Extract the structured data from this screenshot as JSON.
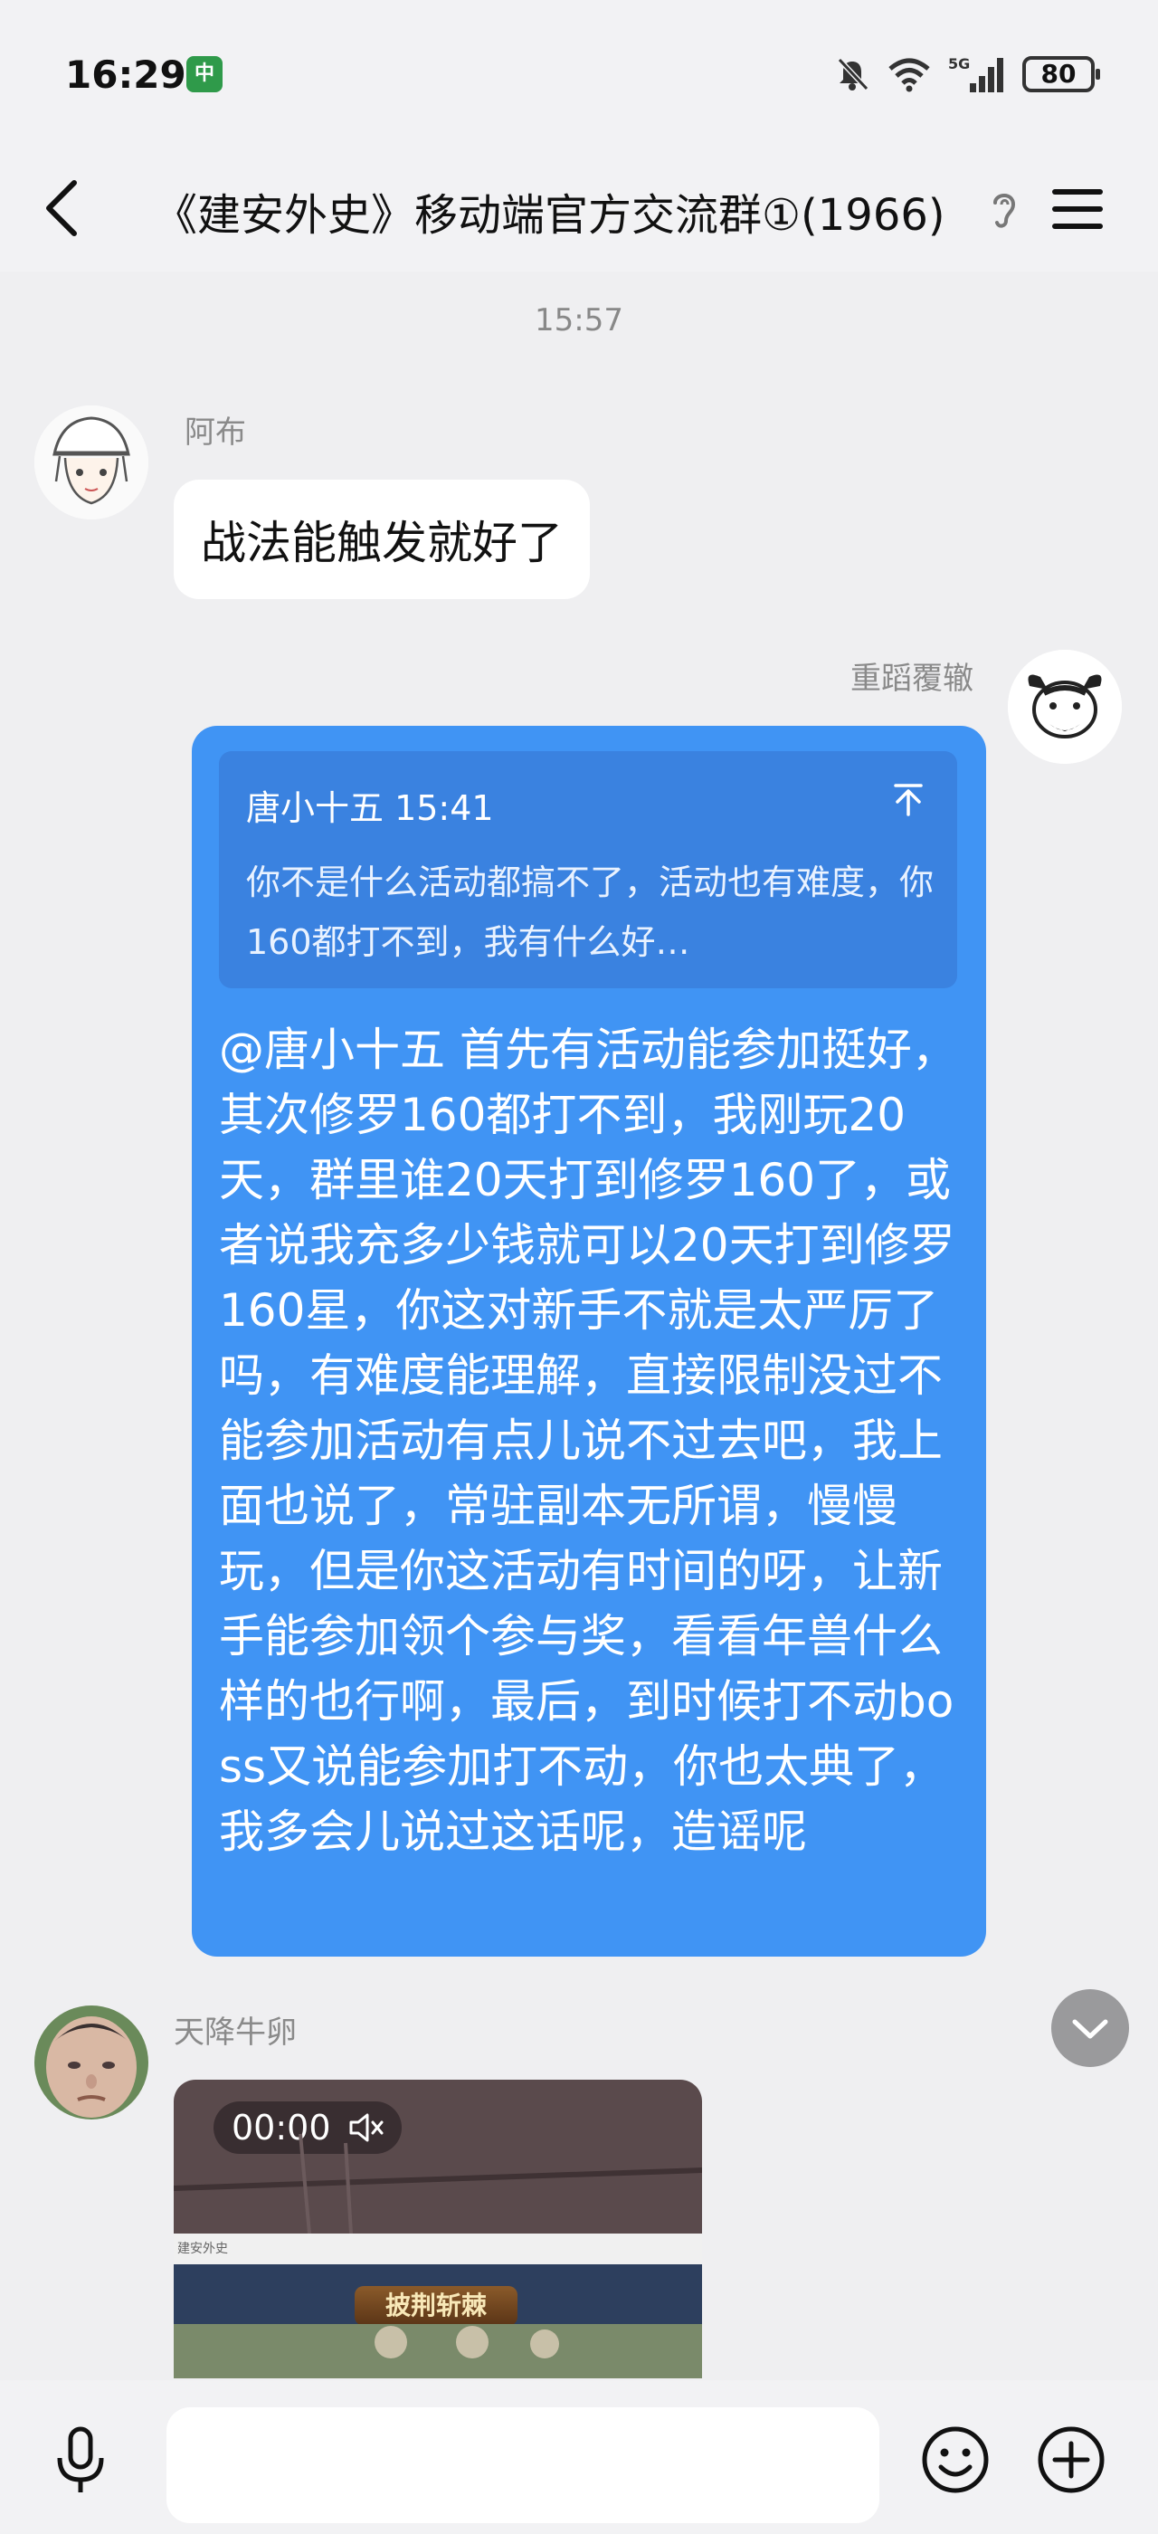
{
  "status_bar": {
    "time": "16:29",
    "app_icon_label": "中",
    "battery": "80"
  },
  "header": {
    "title": "《建安外史》移动端官方交流群①(1966)"
  },
  "chat": {
    "timestamp": "15:57",
    "messages": [
      {
        "sender": "阿布",
        "text": "战法能触发就好了"
      },
      {
        "sender": "重蹈覆辙",
        "quote_header": "唐小十五 15:41",
        "quote_text": "你不是什么活动都搞不了，活动也有难度，你160都打不到，我有什么好…",
        "text": "@唐小十五 首先有活动能参加挺好，其次修罗160都打不到，我刚玩20天，群里谁20天打到修罗160了，或者说我充多少钱就可以20天打到修罗160星，你这对新手不就是太严厉了吗，有难度能理解，直接限制没过不能参加活动有点儿说不过去吧，我上面也说了，常驻副本无所谓，慢慢玩，但是你这活动有时间的呀，让新手能参加领个参与奖，看看年兽什么样的也行啊，最后，到时候打不动boss又说能参加打不动，你也太典了，我多会儿说过这话呢，造谣呢"
      },
      {
        "sender": "天降牛卵",
        "video_duration": "00:00",
        "video_banner": "披荆斩棘",
        "video_topbar": "建安外史"
      }
    ]
  },
  "input": {
    "placeholder": ""
  },
  "colors": {
    "accent_bubble": "#4094f4",
    "quote_bg": "#3a82e0",
    "background": "#efeff1"
  }
}
